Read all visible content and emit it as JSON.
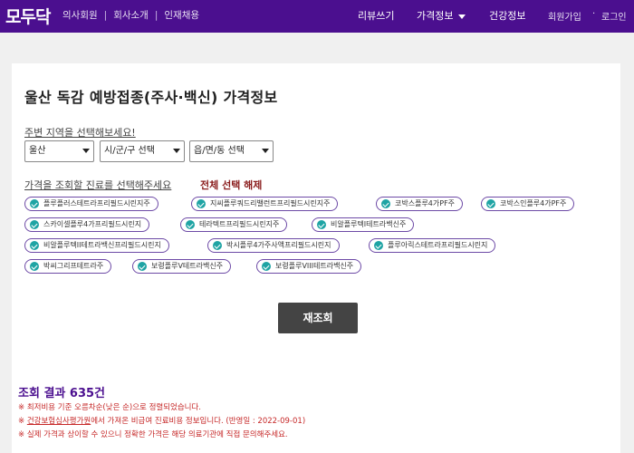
{
  "header": {
    "logo": "모두닥",
    "links": [
      "의사회원",
      "회사소개",
      "인재채용"
    ],
    "separator": "|",
    "nav": {
      "review": "리뷰쓰기",
      "price_info": "가격정보",
      "health_info": "건강정보",
      "signup": "회원가입",
      "dot": "·",
      "login": "로그인"
    },
    "colors": {
      "bar": "#4b0f8f"
    }
  },
  "main": {
    "title": "울산 독감 예방접종(주사·백신) 가격정보",
    "region_label": "주변 지역을 선택해보세요!",
    "selects": {
      "city": "울산",
      "district": "시/군/구 선택",
      "town": "읍/면/동 선택"
    },
    "vaccine_label": "가격을 조회할 진료를 선택해주세요",
    "deselect_all": "전체 선택 해제",
    "chips": [
      "플루플러스테트라프리필드시린지주",
      "지씨플루쿼드리밸런트프리필드시린지주",
      "코박스플루4가PF주",
      "코박스인플루4가PF주",
      "스카이셀플루4가프리필드시린지",
      "테라텍트프리필드시린지주",
      "비알플루텍I테트라백신주",
      "비알플루텍II테트라백신프리필드시린지",
      "박시플루4가주사액프리필드시린지",
      "플루아릭스테트라프리필드시린지",
      "박씨그리프테트라주",
      "보령플루V테트라백신주",
      "보령플루VIII테트라백신주"
    ],
    "search_button": "재조회"
  },
  "results": {
    "label": "조회 결과",
    "count": "635건",
    "notes": {
      "n1": "※ 최저비용 기준 오름차순(낮은 순)으로 정렬되었습니다.",
      "n2_prefix": "※ ",
      "n2_link": "건강보험심사평가원",
      "n2_suffix": "에서 가져온 비급여 진료비용 정보입니다. (반영일 : 2022-09-01)",
      "n3": "※ 실제 가격과 상이할 수 있으니 정확한 가격은 해당 의료기관에 직접 문의해주세요."
    }
  }
}
